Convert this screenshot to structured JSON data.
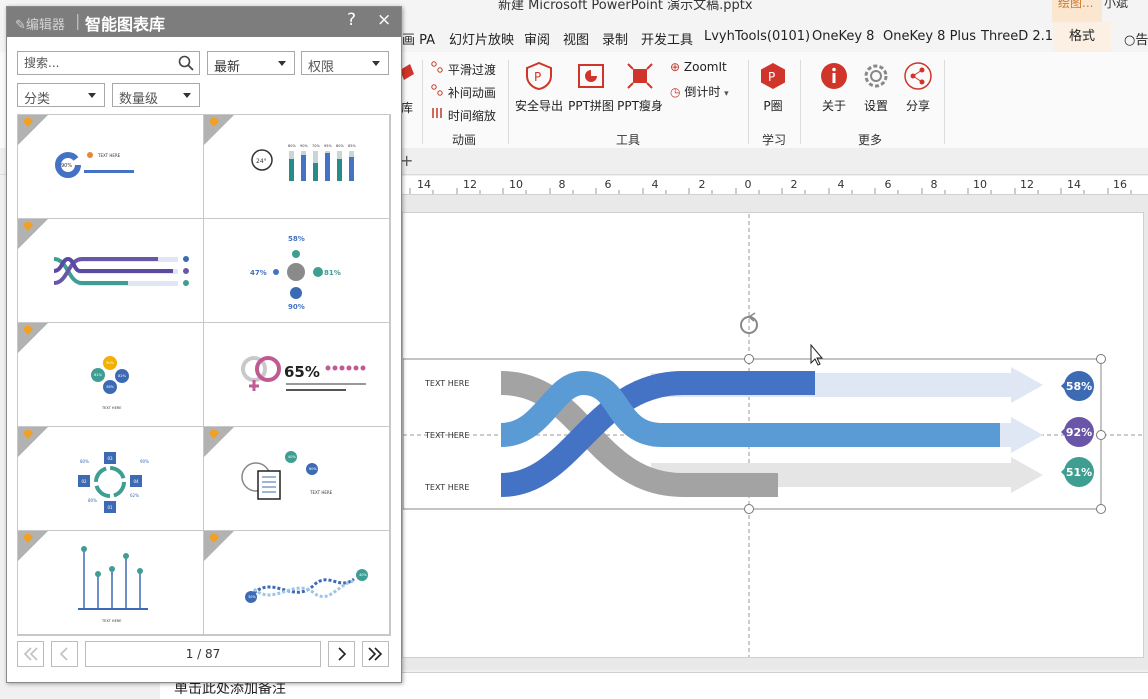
{
  "window": {
    "title": "新建 Microsoft PowerPoint 演示文稿.pptx",
    "context_tab_label": "绘图...",
    "user_name": "小斌"
  },
  "ribbon_tabs": [
    "画 PA",
    "幻灯片放映",
    "审阅",
    "视图",
    "录制",
    "开发工具",
    "LvyhTools(0101)",
    "OneKey 8",
    "OneKey 8 Plus",
    "ThreeD 2.1",
    "格式",
    "告"
  ],
  "ribbon": {
    "partial_button_label": "库",
    "animation_group": {
      "items": [
        "平滑过渡",
        "补间动画",
        "时间缩放"
      ],
      "label": "动画"
    },
    "tools_group": {
      "buttons": [
        "安全导出",
        "PPT拼图",
        "PPT瘦身"
      ],
      "small_items": [
        "ZoomIt",
        "倒计时"
      ],
      "label": "工具"
    },
    "study_group": {
      "button": "P圈",
      "label": "学习"
    },
    "more_group": {
      "buttons": [
        "关于",
        "设置",
        "分享"
      ],
      "label": "更多"
    }
  },
  "ruler": {
    "ticks": [
      "14",
      "12",
      "10",
      "8",
      "6",
      "4",
      "2",
      "0",
      "2",
      "4",
      "6",
      "8",
      "10",
      "12",
      "14",
      "16"
    ]
  },
  "slide": {
    "row_labels": [
      "TEXT HERE",
      "TEXT HERE",
      "TEXT HERE"
    ],
    "percent_badges": [
      "58%",
      "92%",
      "51%"
    ],
    "badge_colors": [
      "#3d6bb3",
      "#6a56a8",
      "#3f9e92"
    ]
  },
  "notes_placeholder": "单击此处添加备注",
  "panel": {
    "editor_label": "编辑器",
    "title": "智能图表库",
    "help_label": "?",
    "close_label": "×",
    "search": {
      "placeholder": "搜索..."
    },
    "sort_select": "最新",
    "permission_select": "权限",
    "category_select": "分类",
    "quantity_select": "数量级",
    "thumbnails": [
      {
        "name": "thumb-donut-progress"
      },
      {
        "name": "thumb-24h-bars"
      },
      {
        "name": "thumb-braided-bars"
      },
      {
        "name": "thumb-people-percent"
      },
      {
        "name": "thumb-circle-cluster"
      },
      {
        "name": "thumb-gender-65"
      },
      {
        "name": "thumb-cycle-steps"
      },
      {
        "name": "thumb-document-circles"
      },
      {
        "name": "thumb-arrow-pins"
      },
      {
        "name": "thumb-dna-wave"
      }
    ],
    "thumb_text": {
      "t1_percent": "90%",
      "t1_text": "TEXT HERE",
      "t2_center": "24°",
      "t2_values": [
        "80%",
        "90%",
        "70%",
        "95%",
        "80%",
        "85%"
      ],
      "t4_values": [
        "58%",
        "47%",
        "81%",
        "90%"
      ],
      "t5_values": [
        "90%",
        "81%",
        "82%",
        "58%"
      ],
      "t5_text": "TEXT HERE",
      "t6_big": "65%",
      "t7_values": [
        "80%",
        "90%",
        "62%",
        "80%"
      ],
      "t7_steps": [
        "03",
        "02",
        "04",
        "01"
      ],
      "t8_values": [
        "40%",
        "60%"
      ],
      "t8_text": "TEXT HERE",
      "t9_text": "TEXT HERE",
      "t10_values": [
        "30%",
        "40%"
      ]
    },
    "pager": {
      "current": "1 / 87"
    }
  }
}
